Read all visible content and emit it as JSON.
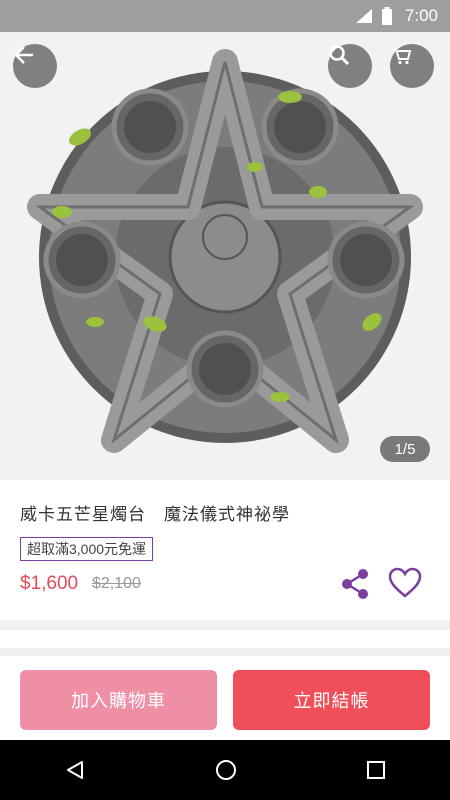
{
  "status": {
    "time": "7:00",
    "network": "4G"
  },
  "gallery": {
    "counter": "1/5"
  },
  "product": {
    "title": "威卡五芒星燭台　魔法儀式神祕學",
    "promo": "超取滿3,000元免運",
    "price": "$1,600",
    "original_price": "$2,100"
  },
  "actions": {
    "add_to_cart": "加入購物車",
    "checkout": "立即結帳"
  },
  "colors": {
    "accent": "#7b3fa0",
    "price": "#e64a5a",
    "cart_button": "#ef8fa6",
    "buy_button": "#f04e58"
  }
}
